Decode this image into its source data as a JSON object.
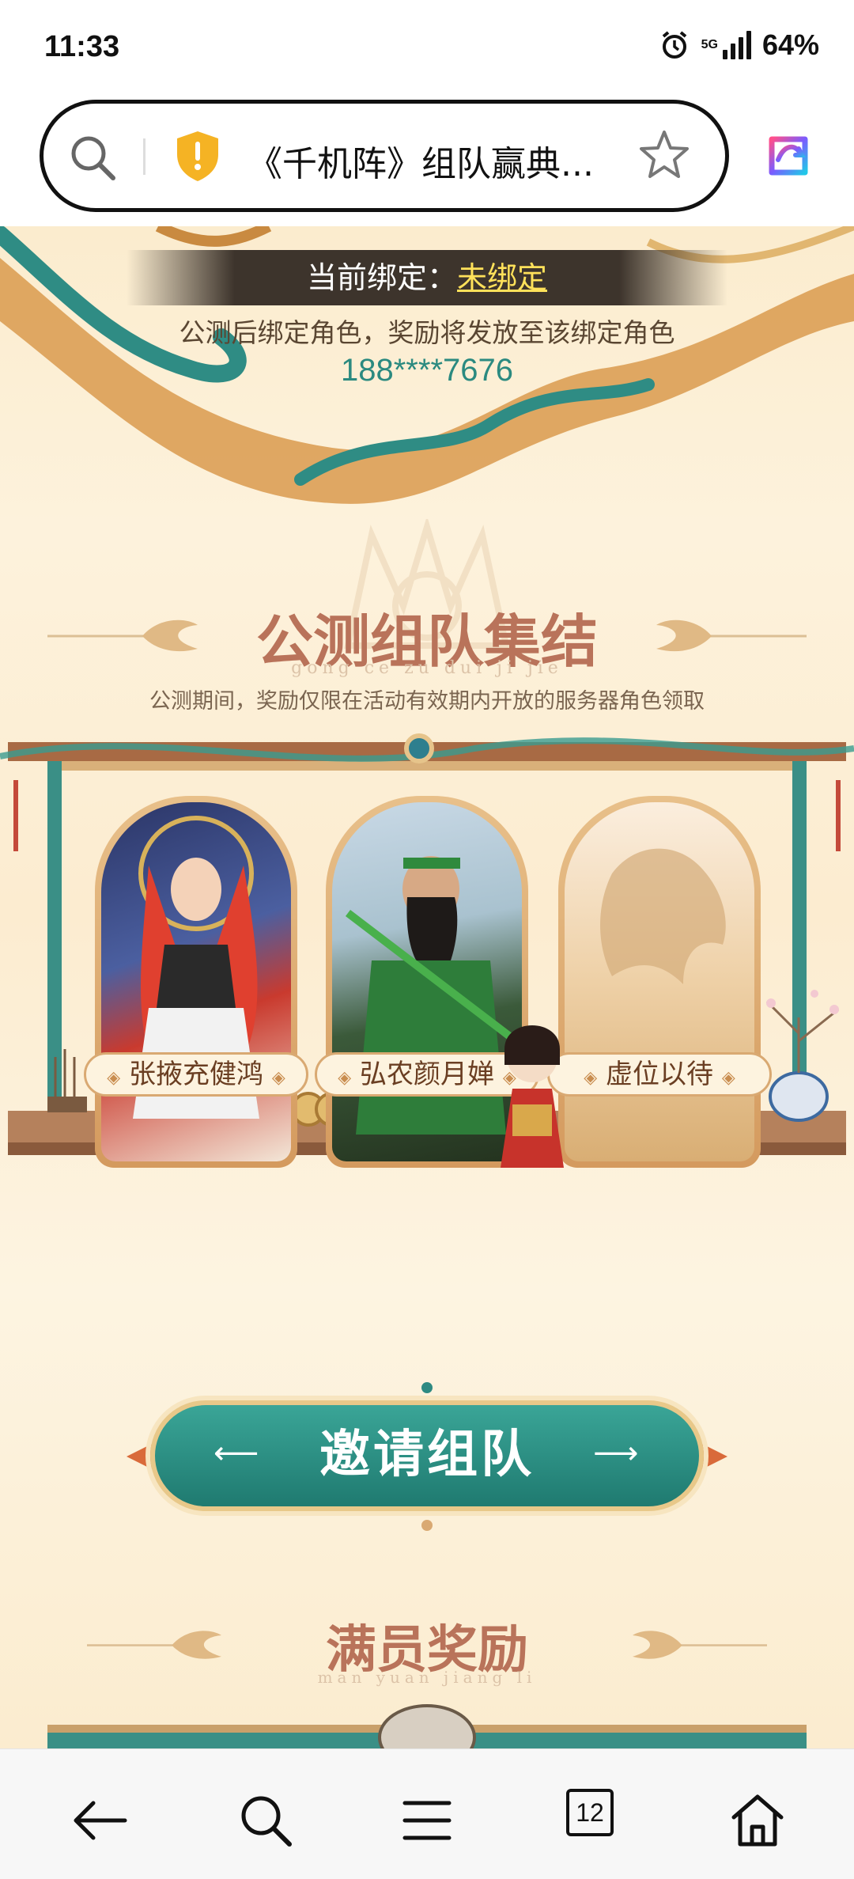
{
  "status_bar": {
    "time": "11:33",
    "network": "5G",
    "battery": "64%"
  },
  "browser": {
    "url_title": "《千机阵》组队赢典...",
    "tabs_count": "12"
  },
  "page": {
    "bind_label": "当前绑定：",
    "bind_status": "未绑定",
    "bind_note": "公测后绑定角色，奖励将发放至该绑定角色",
    "phone": "188****7676",
    "section1": {
      "title": "公测组队集结",
      "pinyin": "gong ce zu dui ji jie",
      "subtitle": "公测期间，奖励仅限在活动有效期内开放的服务器角色领取"
    },
    "cards": [
      {
        "name": "张掖充健鸿"
      },
      {
        "name": "弘农颜月婵"
      },
      {
        "name": "虚位以待"
      }
    ],
    "invite_button": "邀请组队",
    "section2": {
      "title": "满员奖励",
      "pinyin": "man yuan jiang li"
    }
  },
  "colors": {
    "teal": "#2b8a80",
    "gold": "#d9a972",
    "title": "#b9735a"
  }
}
